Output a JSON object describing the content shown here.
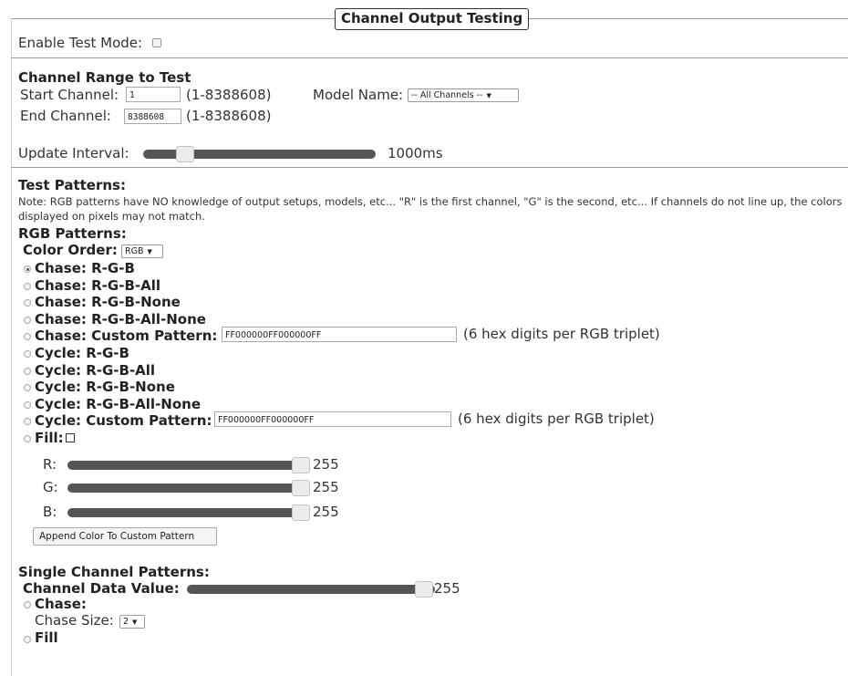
{
  "legend": "Channel Output Testing",
  "enable_test_mode": {
    "label": "Enable Test Mode:",
    "checked": false
  },
  "range": {
    "heading": "Channel Range to Test",
    "start_label": "Start Channel:",
    "start_value": "1",
    "start_hint": "(1-8388608)",
    "end_label": "End Channel:",
    "end_value": "8388608",
    "end_hint": "(1-8388608)",
    "model_label": "Model Name:",
    "model_value": "-- All Channels --"
  },
  "update_interval": {
    "label": "Update Interval:",
    "value_text": "1000ms",
    "level": 0.18
  },
  "test_patterns": {
    "heading": "Test Patterns:",
    "note": "Note: RGB patterns have NO knowledge of output setups, models, etc... \"R\" is the first channel, \"G\" is the second, etc... If channels do not line up, the colors displayed on pixels may not match.",
    "rgb_heading": "RGB Patterns:",
    "color_order_label": "Color Order:",
    "color_order_value": "RGB",
    "options": [
      {
        "label": "Chase: R-G-B",
        "selected": true
      },
      {
        "label": "Chase: R-G-B-All",
        "selected": false
      },
      {
        "label": "Chase: R-G-B-None",
        "selected": false
      },
      {
        "label": "Chase: R-G-B-All-None",
        "selected": false
      },
      {
        "label": "Chase: Custom Pattern:",
        "selected": false
      },
      {
        "label": "Cycle: R-G-B",
        "selected": false
      },
      {
        "label": "Cycle: R-G-B-All",
        "selected": false
      },
      {
        "label": "Cycle: R-G-B-None",
        "selected": false
      },
      {
        "label": "Cycle: R-G-B-All-None",
        "selected": false
      },
      {
        "label": "Cycle: Custom Pattern:",
        "selected": false
      },
      {
        "label": "Fill:",
        "selected": false
      }
    ],
    "chase_custom_value": "FF000000FF000000FF",
    "cycle_custom_value": "FF000000FF000000FF",
    "custom_hint": "(6 hex digits per RGB triplet)",
    "rgb_sliders": [
      {
        "label": "R:",
        "value": "255",
        "level": 1.0
      },
      {
        "label": "G:",
        "value": "255",
        "level": 1.0
      },
      {
        "label": "B:",
        "value": "255",
        "level": 1.0
      }
    ],
    "append_button": "Append Color To Custom Pattern"
  },
  "single_channel": {
    "heading": "Single Channel Patterns:",
    "data_value_label": "Channel Data Value:",
    "data_value": "255",
    "data_level": 1.0,
    "chase_label": "Chase:",
    "chase_size_label": "Chase Size:",
    "chase_size_value": "2",
    "fill_label": "Fill"
  },
  "colors": {
    "track": "#555555",
    "thumb": "#ececec",
    "border": "#999999"
  }
}
